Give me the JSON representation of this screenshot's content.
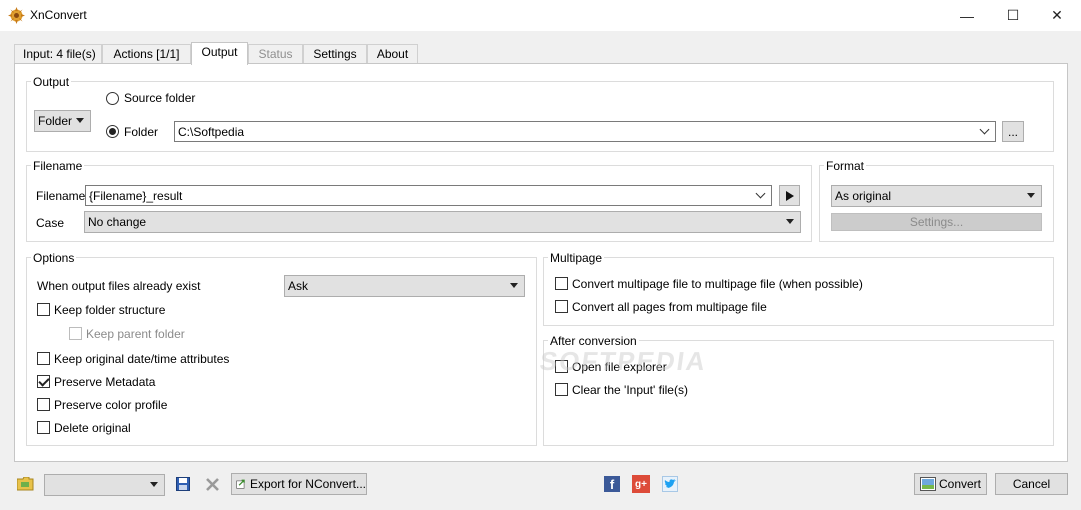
{
  "window": {
    "title": "XnConvert",
    "minimize_glyph": "—",
    "maximize_glyph": "☐",
    "close_glyph": "✕"
  },
  "tabs": [
    {
      "label": "Input: 4 file(s)",
      "state": "normal"
    },
    {
      "label": "Actions [1/1]",
      "state": "normal"
    },
    {
      "label": "Output",
      "state": "active"
    },
    {
      "label": "Status",
      "state": "disabled"
    },
    {
      "label": "Settings",
      "state": "normal"
    },
    {
      "label": "About",
      "state": "normal"
    }
  ],
  "output": {
    "group_label": "Output",
    "type_select": "Folder",
    "source_folder_label": "Source folder",
    "folder_label": "Folder",
    "folder_path": "C:\\Softpedia",
    "browse_label": "..."
  },
  "filename": {
    "group_label": "Filename",
    "filename_label": "Filename",
    "filename_value": "{Filename}_result",
    "case_label": "Case",
    "case_value": "No change"
  },
  "format": {
    "group_label": "Format",
    "format_value": "As original",
    "settings_label": "Settings..."
  },
  "options": {
    "group_label": "Options",
    "exist_label": "When output files already exist",
    "exist_value": "Ask",
    "keep_folder_structure": "Keep folder structure",
    "keep_parent_folder": "Keep parent folder",
    "keep_date_attrs": "Keep original date/time attributes",
    "preserve_metadata": "Preserve Metadata",
    "preserve_color_profile": "Preserve color profile",
    "delete_original": "Delete original"
  },
  "multipage": {
    "group_label": "Multipage",
    "convert_multipage": "Convert multipage file to multipage file (when possible)",
    "convert_all_pages": "Convert all pages from multipage file"
  },
  "after_conversion": {
    "group_label": "After conversion",
    "open_explorer": "Open file explorer",
    "clear_input": "Clear the 'Input' file(s)"
  },
  "bottom": {
    "preset_value": "",
    "export_label": "Export for NConvert...",
    "convert_label": "Convert",
    "cancel_label": "Cancel"
  },
  "colors": {
    "facebook": "#3b5998",
    "google_plus": "#dd4b39",
    "twitter": "#1da1f2",
    "folder": "#e8c24a",
    "save": "#2f5fb3"
  },
  "watermark": "SOFTPEDIA"
}
